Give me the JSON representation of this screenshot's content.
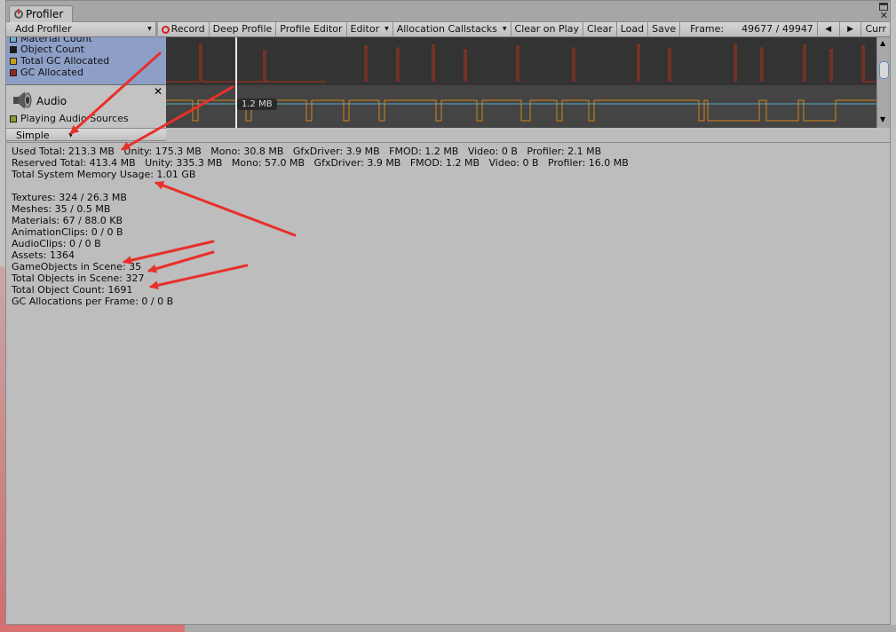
{
  "window": {
    "tab_title": "Profiler"
  },
  "toolbar": {
    "add_profiler": "Add Profiler",
    "record": "Record",
    "deep_profile": "Deep Profile",
    "profile_editor": "Profile Editor",
    "editor": "Editor",
    "allocation_callstacks": "Allocation Callstacks",
    "clear_on_play": "Clear on Play",
    "clear": "Clear",
    "load": "Load",
    "save": "Save",
    "frame_label": "Frame:",
    "frame_value": "49677 / 49947",
    "current": "Curr"
  },
  "memory_module": {
    "legend": [
      {
        "label": "Material Count",
        "color": "#6fb0c8"
      },
      {
        "label": "Object Count",
        "color": "#1a1a1a"
      },
      {
        "label": "Total GC Allocated",
        "color": "#c8a020"
      },
      {
        "label": "GC Allocated",
        "color": "#8b2a1a"
      }
    ]
  },
  "audio_module": {
    "title": "Audio",
    "legend": [
      {
        "label": "Playing Audio Sources",
        "color": "#8a9a30"
      }
    ],
    "tooltip": "1.2 MB"
  },
  "view_mode": {
    "selected": "Simple"
  },
  "stats": {
    "used_total": "Used Total: 213.3 MB   Unity: 175.3 MB   Mono: 30.8 MB   GfxDriver: 3.9 MB   FMOD: 1.2 MB   Video: 0 B   Profiler: 2.1 MB",
    "reserved_total": "Reserved Total: 413.4 MB   Unity: 335.3 MB   Mono: 57.0 MB   GfxDriver: 3.9 MB   FMOD: 1.2 MB   Video: 0 B   Profiler: 16.0 MB",
    "system_memory": "Total System Memory Usage: 1.01 GB",
    "textures": "Textures: 324 / 26.3 MB",
    "meshes": "Meshes: 35 / 0.5 MB",
    "materials": "Materials: 67 / 88.0 KB",
    "animation_clips": "AnimationClips: 0 / 0 B",
    "audio_clips": "AudioClips: 0 / 0 B",
    "assets": "Assets: 1364",
    "gameobjects_in_scene": "GameObjects in Scene: 35",
    "total_objects_in_scene": "Total Objects in Scene: 327",
    "total_object_count": "Total Object Count: 1691",
    "gc_allocations": "GC Allocations per Frame: 0 / 0 B"
  },
  "colors": {
    "annotation_arrow": "#e8302a",
    "mem_chart_line": "#b0301a",
    "audio_chart_line": "#d4841a",
    "audio_chart_line2": "#5aa8c0"
  }
}
